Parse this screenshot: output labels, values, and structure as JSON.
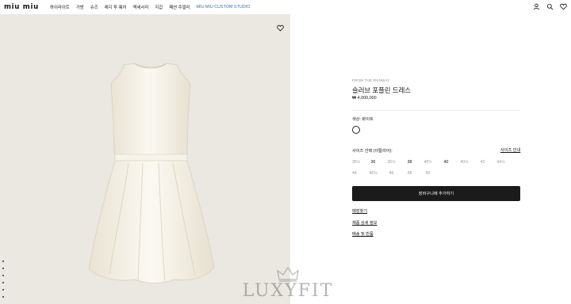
{
  "header": {
    "logo": "miu miu",
    "nav": [
      "하이라이트",
      "가방",
      "슈즈",
      "레디 투 웨어",
      "액세서리",
      "지갑",
      "패션 주얼리",
      "MIU MIU CUSTOM STUDIO"
    ],
    "icons": [
      "user-icon",
      "search-icon",
      "heart-icon"
    ]
  },
  "product": {
    "from": "FROM THE RUNWAY",
    "name": "슬러브 포플린 드레스",
    "price": "₩ 4,000,000",
    "color_label": "색상: 화이트",
    "selected_color": "#ffffff",
    "size_label": "사이즈 선택 (이탈리아):",
    "size_guide": "사이즈 안내",
    "sizes_row1": [
      "36½",
      "36",
      "35½",
      "38",
      "40½",
      "40",
      "40½",
      "42",
      "44½"
    ],
    "sizes_row2": [
      "44",
      "46½",
      "46",
      "48",
      "50"
    ],
    "available_sizes": [
      "36",
      "38",
      "40"
    ],
    "add_to_cart": "장바구니에 추가하기",
    "links": [
      "매장찾기",
      "제품 상세 정보",
      "배송 및 반품"
    ]
  },
  "gallery": {
    "dot_count": 6,
    "wishlist_icon": "heart-icon"
  },
  "watermark": {
    "text": "LUXYFIT"
  }
}
